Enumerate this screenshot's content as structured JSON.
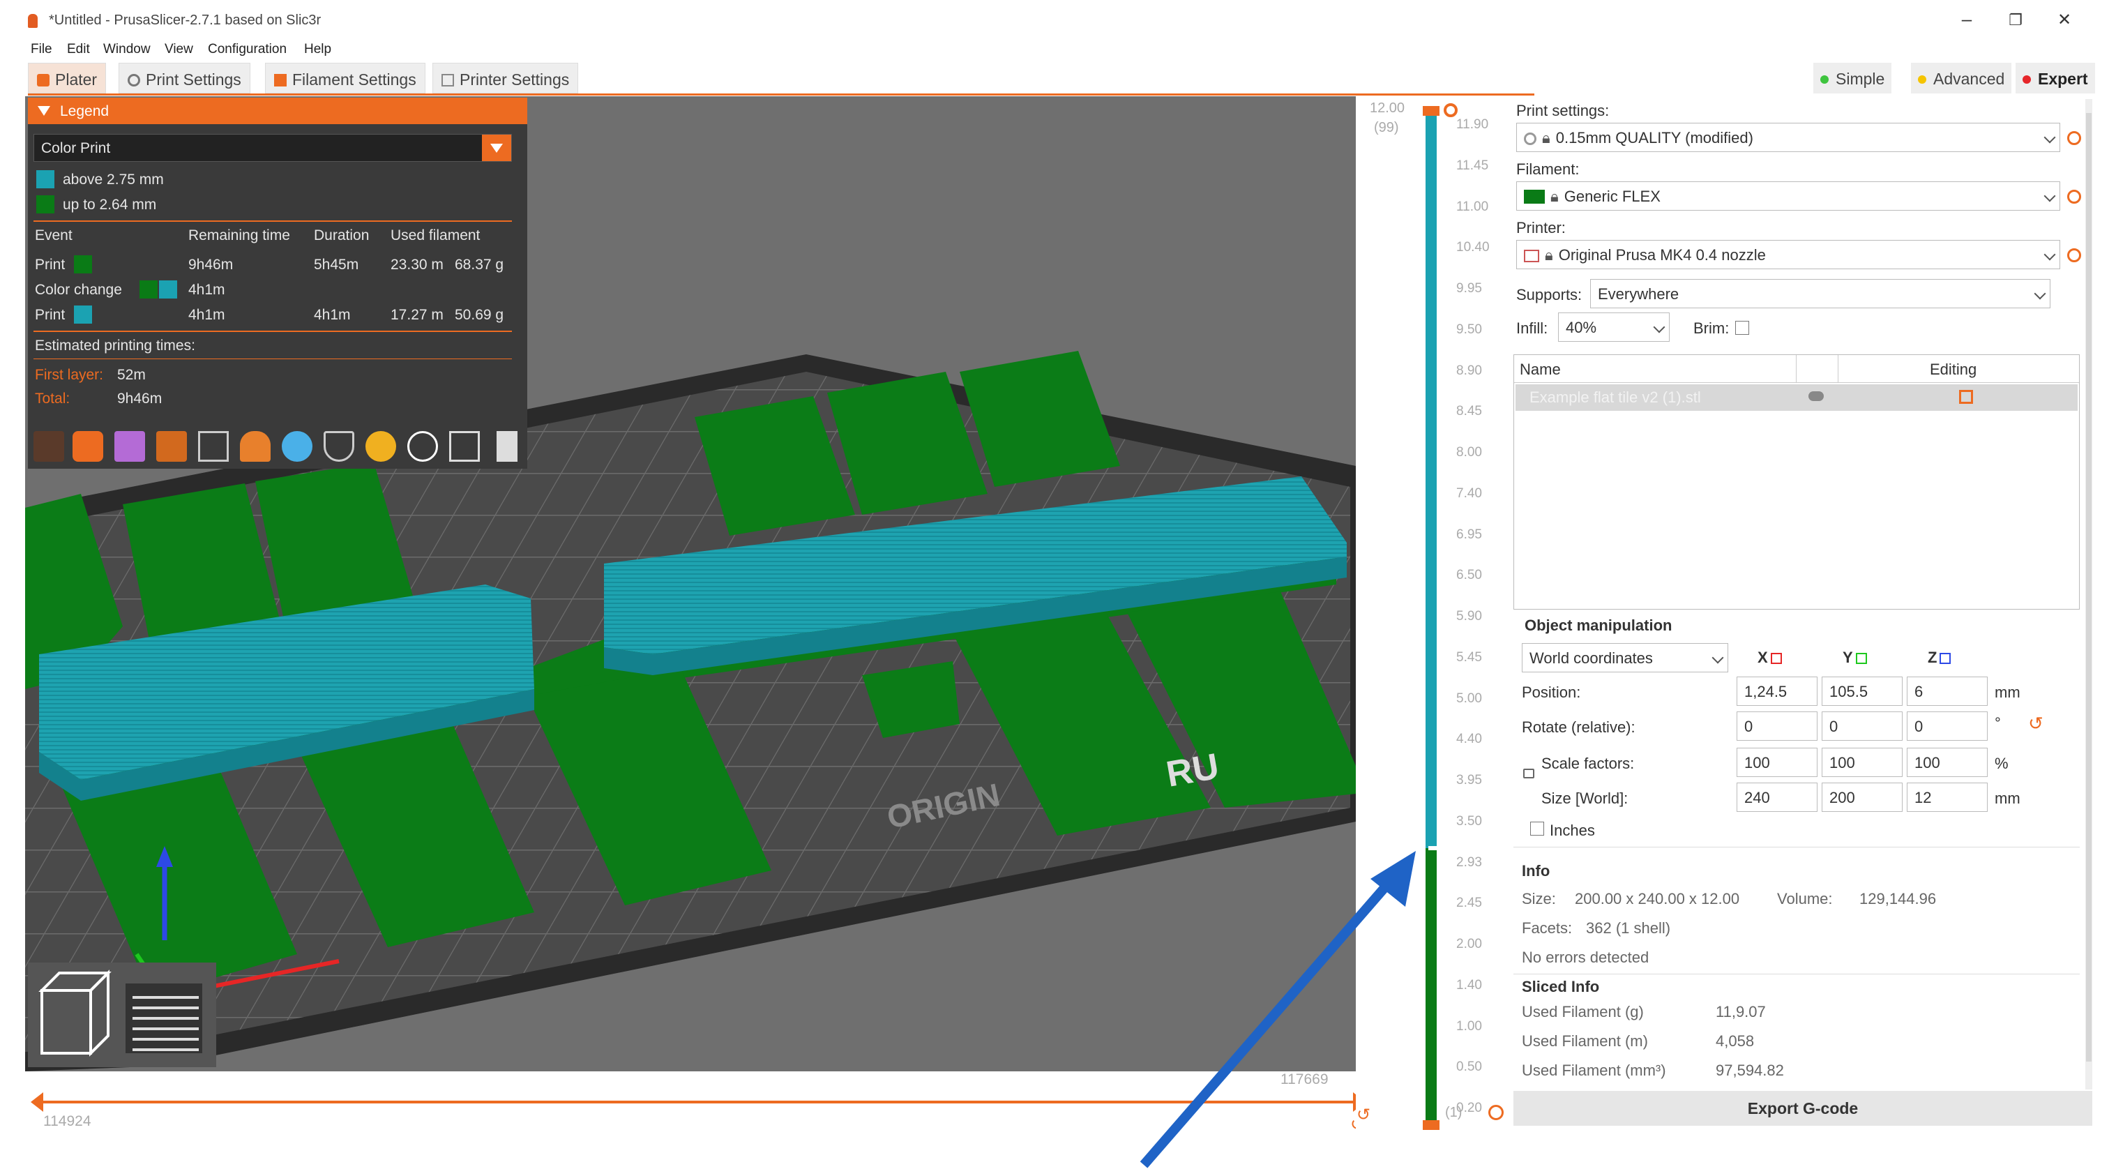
{
  "window": {
    "title": "*Untitled - PrusaSlicer-2.7.1 based on Slic3r",
    "controls": [
      "–",
      "❐",
      "✕"
    ]
  },
  "menu": [
    "File",
    "Edit",
    "Window",
    "View",
    "Configuration",
    "Help"
  ],
  "tabs": [
    {
      "label": "Plater",
      "active": true
    },
    {
      "label": "Print Settings"
    },
    {
      "label": "Filament Settings"
    },
    {
      "label": "Printer Settings"
    }
  ],
  "modes": [
    {
      "label": "Simple",
      "color": "#3ec43e"
    },
    {
      "label": "Advanced",
      "color": "#f5c400"
    },
    {
      "label": "Expert",
      "color": "#e6262a",
      "active": true
    }
  ],
  "legend": {
    "title": "Legend",
    "view_type": "Color Print",
    "ranges": [
      {
        "label": "above 2.75 mm",
        "color": "#1ba2b2"
      },
      {
        "label": "up to 2.64 mm",
        "color": "#0a7b16"
      }
    ],
    "columns": [
      "Event",
      "Remaining time",
      "Duration",
      "Used filament"
    ],
    "rows": [
      {
        "event": "Print",
        "colors": [
          "#0a7b16"
        ],
        "remaining": "9h46m",
        "duration": "5h45m",
        "length": "23.30 m",
        "weight": "68.37 g"
      },
      {
        "event": "Color change",
        "colors": [
          "#0a7b16",
          "#1ba2b2"
        ],
        "remaining": "4h1m",
        "duration": "",
        "length": "",
        "weight": ""
      },
      {
        "event": "Print",
        "colors": [
          "#1ba2b2"
        ],
        "remaining": "4h1m",
        "duration": "4h1m",
        "length": "17.27 m",
        "weight": "50.69 g"
      }
    ],
    "estimated_title": "Estimated printing times:",
    "first_layer_label": "First layer:",
    "first_layer_value": "52m",
    "total_label": "Total:",
    "total_value": "9h46m"
  },
  "bed_text": {
    "origin": "ORIGIN",
    "prusa": "RU"
  },
  "hslider": {
    "left_value": "114924",
    "right_value": "117669"
  },
  "vslider": {
    "top_value": "12.00",
    "top_layer": "(99)",
    "bottom_layer": "(1)",
    "ticks": [
      "11.90",
      "11.45",
      "11.00",
      "10.40",
      "9.95",
      "9.50",
      "8.90",
      "8.45",
      "8.00",
      "7.40",
      "6.95",
      "6.50",
      "5.90",
      "5.45",
      "5.00",
      "4.40",
      "3.95",
      "3.50",
      "2.93",
      "2.45",
      "2.00",
      "1.40",
      "1.00",
      "0.50",
      "0.20"
    ],
    "color_change_at_fraction": 0.73
  },
  "panel": {
    "print_settings_label": "Print settings:",
    "print_settings_value": "0.15mm QUALITY (modified)",
    "filament_label": "Filament:",
    "filament_value": "Generic FLEX",
    "filament_color": "#0a7b16",
    "printer_label": "Printer:",
    "printer_value": "Original Prusa MK4 0.4 nozzle",
    "supports_label": "Supports:",
    "supports_value": "Everywhere",
    "infill_label": "Infill:",
    "infill_value": "40%",
    "brim_label": "Brim:",
    "object_list_columns": [
      "Name",
      "Editing"
    ],
    "object_name": "Example flat tile v2 (1).stl",
    "manip_title": "Object manipulation",
    "coord_system": "World coordinates",
    "axes": [
      "X",
      "Y",
      "Z"
    ],
    "position_label": "Position:",
    "position": [
      "1,24.5",
      "105.5",
      "6"
    ],
    "position_unit": "mm",
    "rotate_label": "Rotate (relative):",
    "rotate": [
      "0",
      "0",
      "0"
    ],
    "rotate_unit": "°",
    "scale_label": "Scale factors:",
    "scale": [
      "100",
      "100",
      "100"
    ],
    "scale_unit": "%",
    "size_label": "Size [World]:",
    "size": [
      "240",
      "200",
      "12"
    ],
    "size_unit": "mm",
    "inches_label": "Inches",
    "info_title": "Info",
    "size_info_label": "Size:",
    "size_info_value": "200.00 x 240.00 x 12.00",
    "volume_label": "Volume:",
    "volume_value": "129,144.96",
    "facets_label": "Facets:",
    "facets_value": "362 (1 shell)",
    "errors_text": "No errors detected",
    "sliced_title": "Sliced Info",
    "used_g_label": "Used Filament (g)",
    "used_g_value": "11,9.07",
    "used_m_label": "Used Filament (m)",
    "used_m_value": "4,058",
    "used_mm3_label": "Used Filament (mm³)",
    "used_mm3_value": "97,594.82",
    "export_label": "Export G-code"
  }
}
